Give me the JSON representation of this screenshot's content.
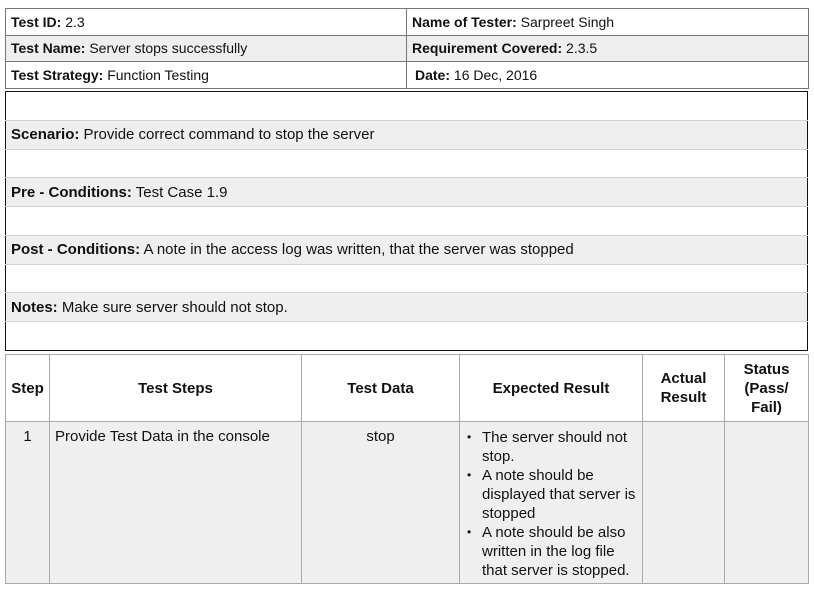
{
  "info": {
    "test_id_label": "Test ID:",
    "test_id": "2.3",
    "tester_label": "Name of Tester:",
    "tester": "Sarpreet Singh",
    "test_name_label": "Test Name:",
    "test_name": "Server stops successfully",
    "requirement_label": "Requirement Covered:",
    "requirement": "2.3.5",
    "strategy_label": "Test Strategy:",
    "strategy": "Function Testing",
    "date_label": "Date:",
    "date": "16 Dec, 2016"
  },
  "scenario": {
    "scenario_label": "Scenario:",
    "scenario": "Provide correct command to stop the server",
    "pre_label": "Pre - Conditions:",
    "pre": "Test Case 1.9",
    "post_label": "Post - Conditions:",
    "post": "A note in the access log was written, that the server was stopped",
    "notes_label": "Notes:",
    "notes": "Make sure server should not stop."
  },
  "steps": {
    "headers": {
      "step": "Step",
      "test_steps": "Test Steps",
      "test_data": "Test Data",
      "expected": "Expected Result",
      "actual_1": "Actual",
      "actual_2": "Result",
      "status_1": "Status",
      "status_2": "(Pass/",
      "status_3": "Fail)"
    },
    "rows": [
      {
        "step": "1",
        "test_step": "Provide Test Data in the console",
        "test_data": "stop",
        "expected": [
          "The server should not stop.",
          "A note should be displayed that server is stopped",
          "A note should be also written in the log file that server is stopped."
        ],
        "actual": "",
        "status": ""
      }
    ]
  }
}
